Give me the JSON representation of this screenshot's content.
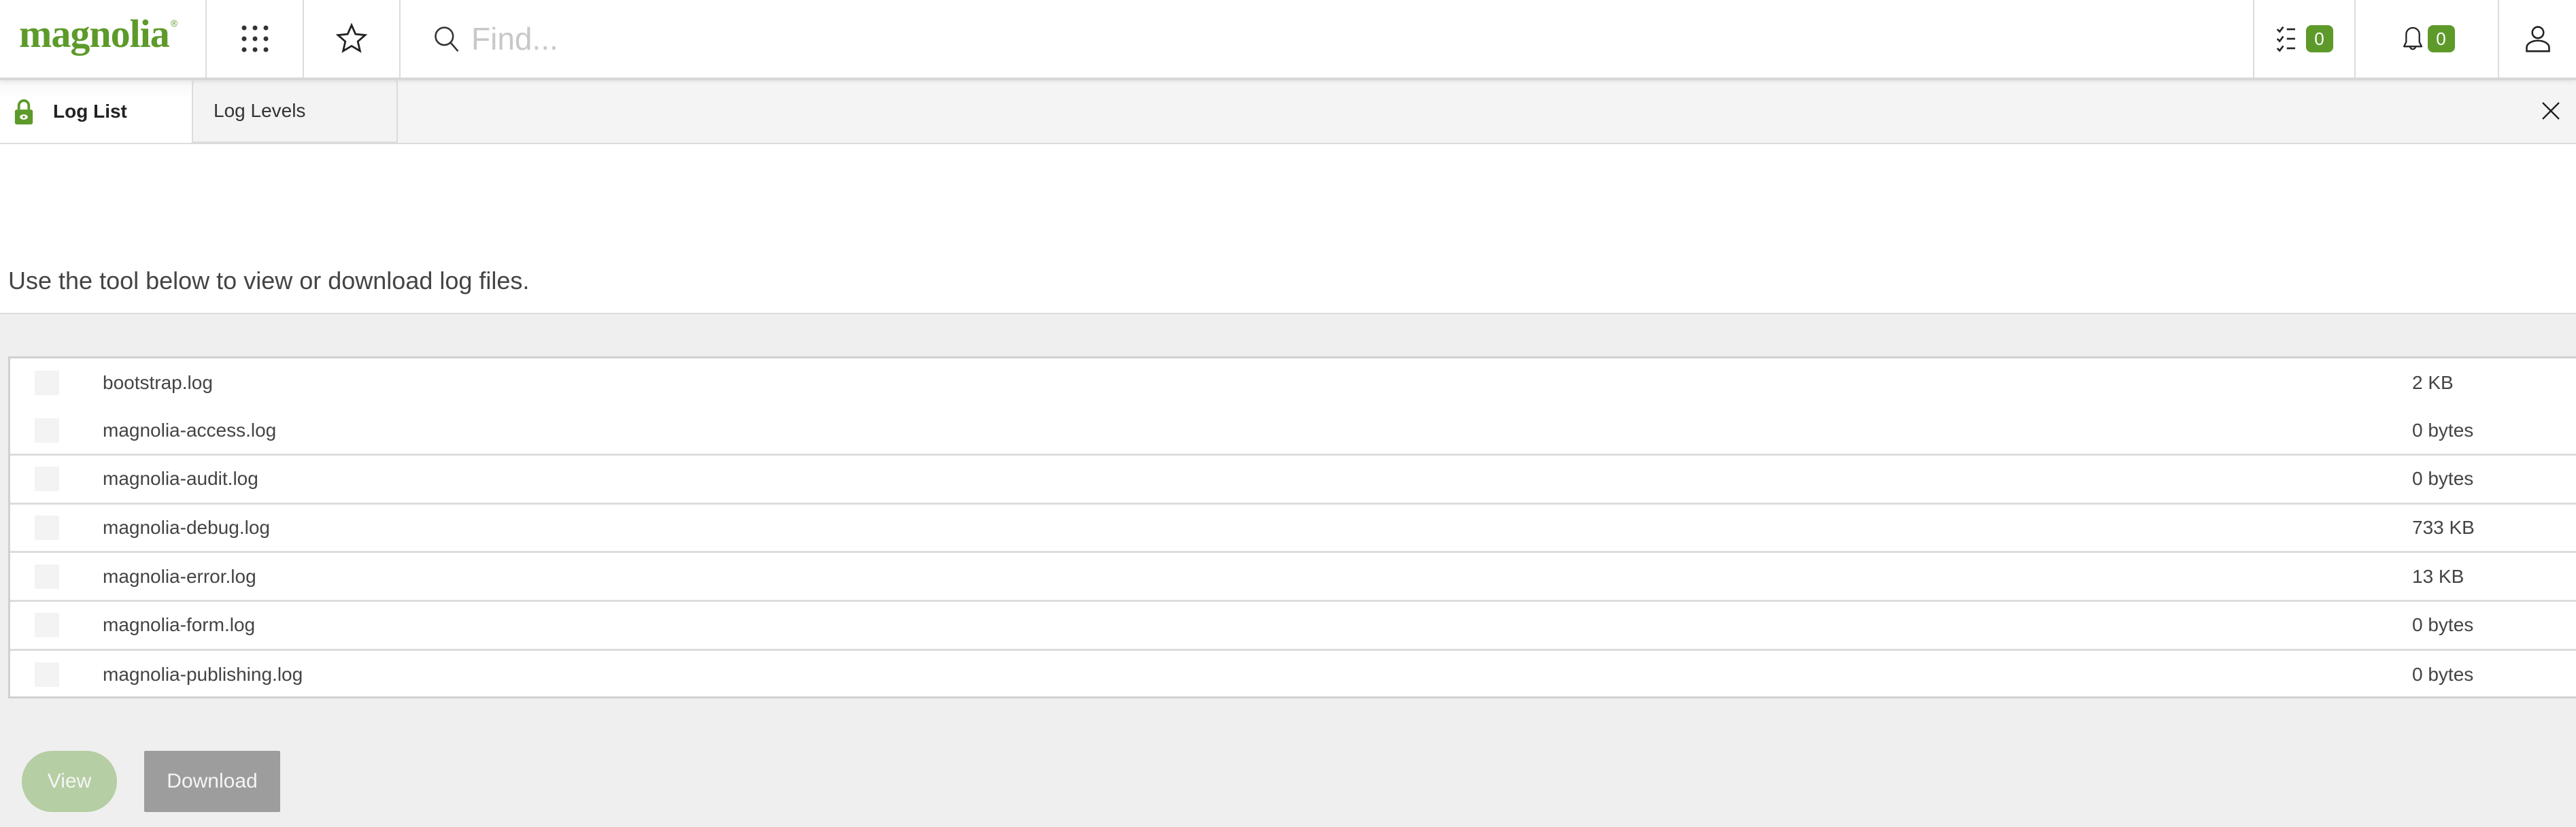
{
  "header": {
    "logo_text": "magnolia",
    "logo_reg": "®",
    "search_placeholder": "Find...",
    "tasks_count": "0",
    "notifications_count": "0"
  },
  "tabs": [
    {
      "label": "Log List",
      "active": true,
      "icon": "lock-icon"
    },
    {
      "label": "Log Levels",
      "active": false
    }
  ],
  "intro": {
    "text": "Use the tool below to view or download log files."
  },
  "files": [
    {
      "name": "bootstrap.log",
      "size": "2 KB"
    },
    {
      "name": "magnolia-access.log",
      "size": "0 bytes"
    },
    {
      "name": "magnolia-audit.log",
      "size": "0 bytes"
    },
    {
      "name": "magnolia-debug.log",
      "size": "733 KB"
    },
    {
      "name": "magnolia-error.log",
      "size": "13 KB"
    },
    {
      "name": "magnolia-form.log",
      "size": "0 bytes"
    },
    {
      "name": "magnolia-publishing.log",
      "size": "0 bytes"
    }
  ],
  "actions": {
    "view_label": "View",
    "download_label": "Download"
  },
  "colors": {
    "brand": "#5d9a2a",
    "view_button_disabled": "#b5cea3",
    "download_button_disabled": "#9d9d9d"
  }
}
